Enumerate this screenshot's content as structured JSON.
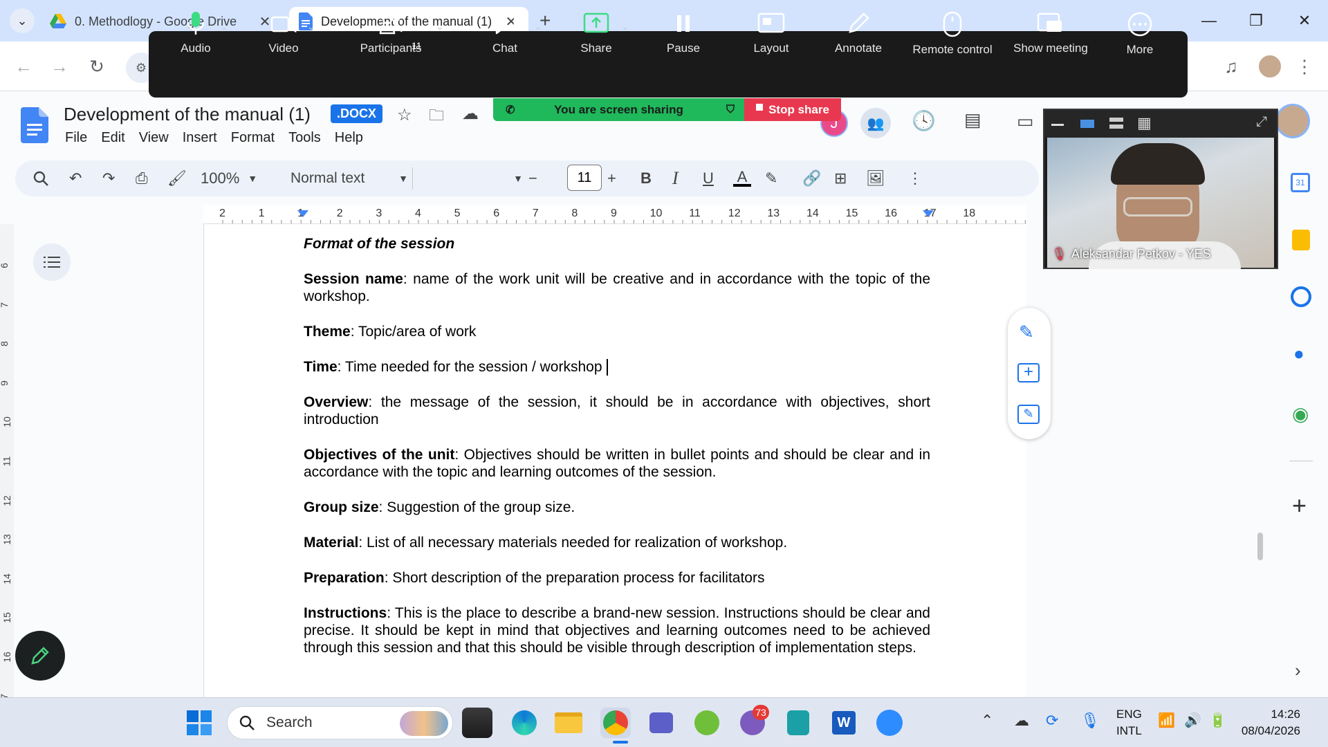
{
  "browser": {
    "tabs": [
      {
        "title": "0. Methodlogy - Google Drive"
      },
      {
        "title": "Development of the manual (1)"
      }
    ],
    "new_tab": "+"
  },
  "zoom": {
    "toolbar": [
      {
        "label": "Audio",
        "icon": "microphone-icon"
      },
      {
        "label": "Video",
        "icon": "camera-icon"
      },
      {
        "label": "Participants",
        "icon": "participants-icon",
        "badge": "11"
      },
      {
        "label": "Chat",
        "icon": "chat-icon"
      },
      {
        "label": "Share",
        "icon": "share-icon"
      },
      {
        "label": "Pause",
        "icon": "pause-icon"
      },
      {
        "label": "Layout",
        "icon": "layout-icon"
      },
      {
        "label": "Annotate",
        "icon": "pencil-icon"
      },
      {
        "label": "Remote control",
        "icon": "mouse-icon"
      },
      {
        "label": "Show meeting",
        "icon": "show-meeting-icon"
      },
      {
        "label": "More",
        "icon": "more-icon"
      }
    ],
    "sharing_banner": "You are screen sharing",
    "stop_share": "Stop share",
    "video_name": "Aleksandar Petkov - YES",
    "accent": "#1fb85b",
    "stop_color": "#e8384f"
  },
  "docs": {
    "title": "Development of the manual (1)",
    "badge": ".DOCX",
    "menu": [
      "File",
      "Edit",
      "View",
      "Insert",
      "Format",
      "Tools",
      "Help"
    ],
    "toolbar": {
      "zoom": "100%",
      "style": "Normal text",
      "font_size": "11"
    },
    "ruler_ticks": [
      "2",
      "1",
      "1",
      "2",
      "3",
      "4",
      "5",
      "6",
      "7",
      "8",
      "9",
      "10",
      "11",
      "12",
      "13",
      "14",
      "15",
      "16",
      "17",
      "18"
    ],
    "vruler_ticks": [
      "6",
      "7",
      "8",
      "9",
      "10",
      "11",
      "12",
      "13",
      "14",
      "15",
      "16",
      "7"
    ],
    "heading": "Format of the session",
    "paragraphs": [
      {
        "label": "Session name",
        "text": ": name of the work unit will be creative and in accordance with the topic of the workshop."
      },
      {
        "label": "Theme",
        "text": ": Topic/area of work"
      },
      {
        "label": "Time",
        "text": ": Time needed for the session / workshop"
      },
      {
        "label": "Overview",
        "text": ": the message of the session, it should be in accordance with objectives, short introduction"
      },
      {
        "label": "Objectives of the unit",
        "text": ": Objectives should be written in bullet points and should be clear and in accordance with the topic and learning outcomes of the session."
      },
      {
        "label": "Group size",
        "text": ": Suggestion of the group size."
      },
      {
        "label": "Material",
        "text": ": List of all necessary materials needed for realization of workshop."
      },
      {
        "label": "Preparation",
        "text": ": Short description of the preparation process for facilitators"
      },
      {
        "label": "Instructions",
        "text": ": This is the place to describe a brand-new session. Instructions should be clear and precise. It should be kept in mind that objectives and learning outcomes need to be achieved through this session and that this should be visible through description of implementation steps."
      }
    ],
    "avatar_letter": "J"
  },
  "taskbar": {
    "search": "Search",
    "viber_badge": "73",
    "lang_top": "ENG",
    "lang_bottom": "INTL",
    "time": "14:26",
    "date": "08/04/2026"
  }
}
